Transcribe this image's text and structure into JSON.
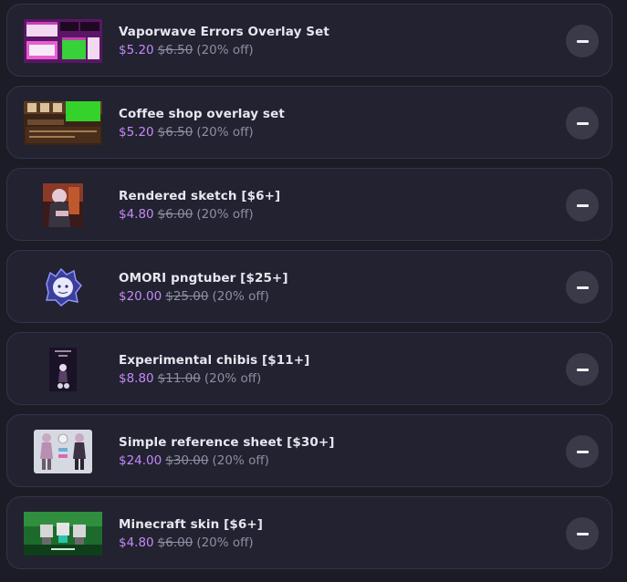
{
  "cart": {
    "items": [
      {
        "title": "Vaporwave Errors Overlay Set",
        "price": "$5.20",
        "original": "$6.50",
        "discount": "(20% off)",
        "thumb": "vaporwave-overlay-thumbnail"
      },
      {
        "title": "Coffee shop overlay set",
        "price": "$5.20",
        "original": "$6.50",
        "discount": "(20% off)",
        "thumb": "coffee-shop-overlay-thumbnail"
      },
      {
        "title": "Rendered sketch [$6+]",
        "price": "$4.80",
        "original": "$6.00",
        "discount": "(20% off)",
        "thumb": "rendered-sketch-thumbnail"
      },
      {
        "title": "OMORI pngtuber [$25+]",
        "price": "$20.00",
        "original": "$25.00",
        "discount": "(20% off)",
        "thumb": "omori-pngtuber-thumbnail"
      },
      {
        "title": "Experimental chibis [$11+]",
        "price": "$8.80",
        "original": "$11.00",
        "discount": "(20% off)",
        "thumb": "experimental-chibis-thumbnail"
      },
      {
        "title": "Simple reference sheet [$30+]",
        "price": "$24.00",
        "original": "$30.00",
        "discount": "(20% off)",
        "thumb": "reference-sheet-thumbnail"
      },
      {
        "title": "Minecraft skin [$6+]",
        "price": "$4.80",
        "original": "$6.00",
        "discount": "(20% off)",
        "thumb": "minecraft-skin-thumbnail"
      }
    ],
    "remove_icon": "minus-icon"
  },
  "colors": {
    "background": "#1c1c27",
    "card": "#222230",
    "price": "#c58af9",
    "muted": "#8e8ea3",
    "button": "#3a3a48"
  }
}
